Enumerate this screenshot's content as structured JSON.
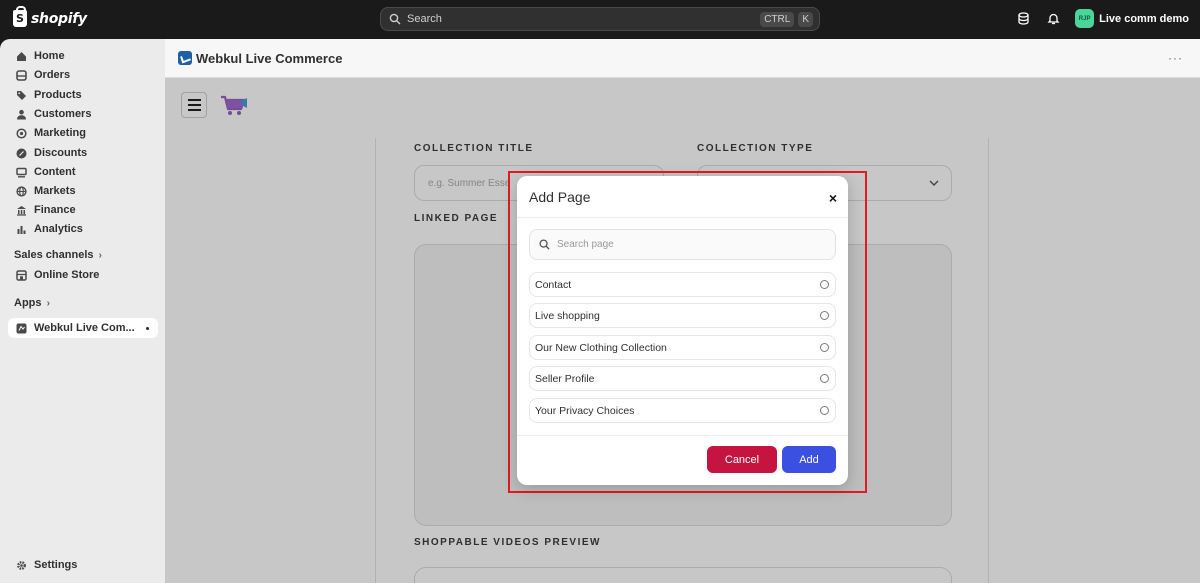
{
  "topbar": {
    "brand": "shopify",
    "search_placeholder": "Search",
    "shortcut_keys": [
      "CTRL",
      "K"
    ],
    "store_initials": "RJP",
    "store_name": "Live comm demo"
  },
  "sidebar": {
    "items": [
      {
        "label": "Home",
        "icon": "home-icon"
      },
      {
        "label": "Orders",
        "icon": "orders-icon"
      },
      {
        "label": "Products",
        "icon": "tag-icon"
      },
      {
        "label": "Customers",
        "icon": "person-icon"
      },
      {
        "label": "Marketing",
        "icon": "target-icon"
      },
      {
        "label": "Discounts",
        "icon": "discount-icon"
      },
      {
        "label": "Content",
        "icon": "content-icon"
      },
      {
        "label": "Markets",
        "icon": "globe-icon"
      },
      {
        "label": "Finance",
        "icon": "bank-icon"
      },
      {
        "label": "Analytics",
        "icon": "chart-icon"
      }
    ],
    "sales_channels_label": "Sales channels",
    "online_store_label": "Online Store",
    "apps_label": "Apps",
    "active_app_label": "Webkul Live Com...",
    "settings_label": "Settings"
  },
  "app": {
    "title": "Webkul Live Commerce",
    "more": "···"
  },
  "form": {
    "collection_title_label": "COLLECTION TITLE",
    "collection_title_placeholder": "e.g. Summer Esse",
    "collection_type_label": "COLLECTION TYPE",
    "linked_page_label": "LINKED PAGE",
    "shoppable_preview_label": "SHOPPABLE VIDEOS PREVIEW"
  },
  "modal": {
    "title": "Add Page",
    "close": "×",
    "search_placeholder": "Search page",
    "pages": [
      "Contact",
      "Live shopping",
      "Our New Clothing Collection",
      "Seller Profile",
      "Your Privacy Choices"
    ],
    "cancel_label": "Cancel",
    "add_label": "Add"
  },
  "colors": {
    "cancel": "#c5143f",
    "add": "#3b4fe0",
    "highlight": "#e01b24"
  }
}
